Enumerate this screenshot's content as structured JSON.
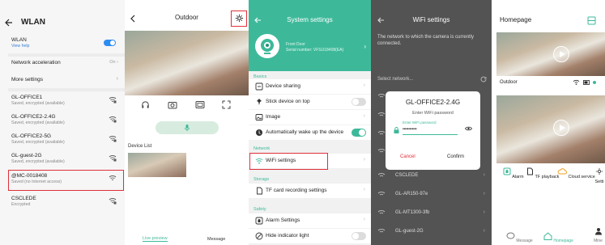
{
  "wlan": {
    "title": "WLAN",
    "wlan_label": "WLAN",
    "view_help": "View help",
    "net_accel_label": "Network acceleration",
    "net_accel_value": "On",
    "more_settings": "More settings",
    "networks": [
      {
        "name": "GL-OFFICE1",
        "status": "Saved, encrypted (available)"
      },
      {
        "name": "GL-OFFICE2-2.4G",
        "status": "Saved, encrypted (available)"
      },
      {
        "name": "GL-OFFICE2-5G",
        "status": "Saved, encrypted (available)"
      },
      {
        "name": "GL-guest-2G",
        "status": "Saved, encrypted (available)"
      },
      {
        "name": "@MC-0018408",
        "status": "Saved (no Internet access)"
      },
      {
        "name": "CSCLEDE",
        "status": "Encrypted"
      }
    ]
  },
  "outdoor": {
    "title": "Outdoor",
    "device_list_label": "Device List",
    "tab_live": "Live preview",
    "tab_message": "Message"
  },
  "system_settings": {
    "title": "System settings",
    "device_name": "Front Door",
    "serial": "Serial number: VFSU18408(EA)",
    "section_basics": "Basics",
    "device_sharing": "Device sharing",
    "stick_top": "Stick device on top",
    "image": "Image",
    "auto_wake": "Automatically wake up the device",
    "section_network": "Network",
    "wifi_settings": "WiFi settings",
    "section_storage": "Storage",
    "tf_card": "TF card recording settings",
    "section_safety": "Safety",
    "alarm_settings": "Alarm Settings",
    "hide_indicator": "Hide indicator light"
  },
  "wifi_settings": {
    "title": "WiFi settings",
    "description": "The network to which the camera is currently connected.",
    "select_network": "Select network...",
    "networks_bg": [
      "CSCLEDE",
      "GL-AR150-97e",
      "GL-MT1300-3fb",
      "GL-guest-2G"
    ],
    "dialog": {
      "network": "GL-OFFICE2-2.4G",
      "prompt": "Enter WiFi password",
      "field_label": "Enter WiFi password",
      "password_mask": "••••••••••••",
      "cancel": "Cancel",
      "confirm": "Confirm"
    }
  },
  "homepage": {
    "title": "Homepage",
    "camera_name": "Outdoor",
    "quick": [
      "Alarm",
      "TF playback",
      "Cloud service",
      "Setti"
    ],
    "nav": [
      "Message",
      "Homepage",
      "Mine"
    ]
  },
  "colors": {
    "accent_green": "#3db99a",
    "blue": "#2d8cf0",
    "highlight_red": "#e0303a",
    "toggle_on": "#2d8cf0"
  }
}
